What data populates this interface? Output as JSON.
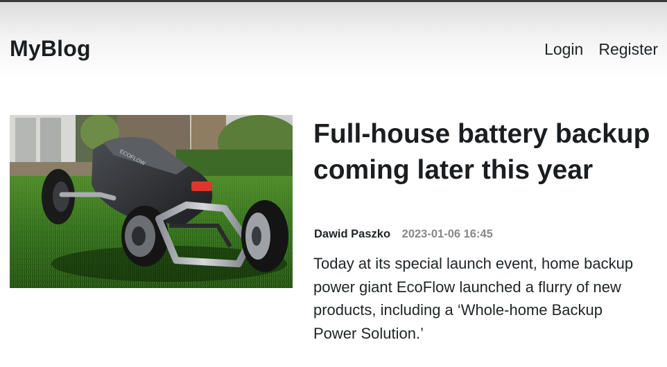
{
  "header": {
    "brand": "MyBlog",
    "nav": {
      "login": "Login",
      "register": "Register"
    }
  },
  "post": {
    "title": "Full-house battery backup coming later this year",
    "author": "Dawid Paszko",
    "date": "2023-01-06 16:45",
    "excerpt": "Today at its special launch event, home backup power giant EcoFlow launched a flurry of new products, including a ‘Whole-home Backup Power Solution.’",
    "image_brand_text": "ECOFLOW"
  }
}
